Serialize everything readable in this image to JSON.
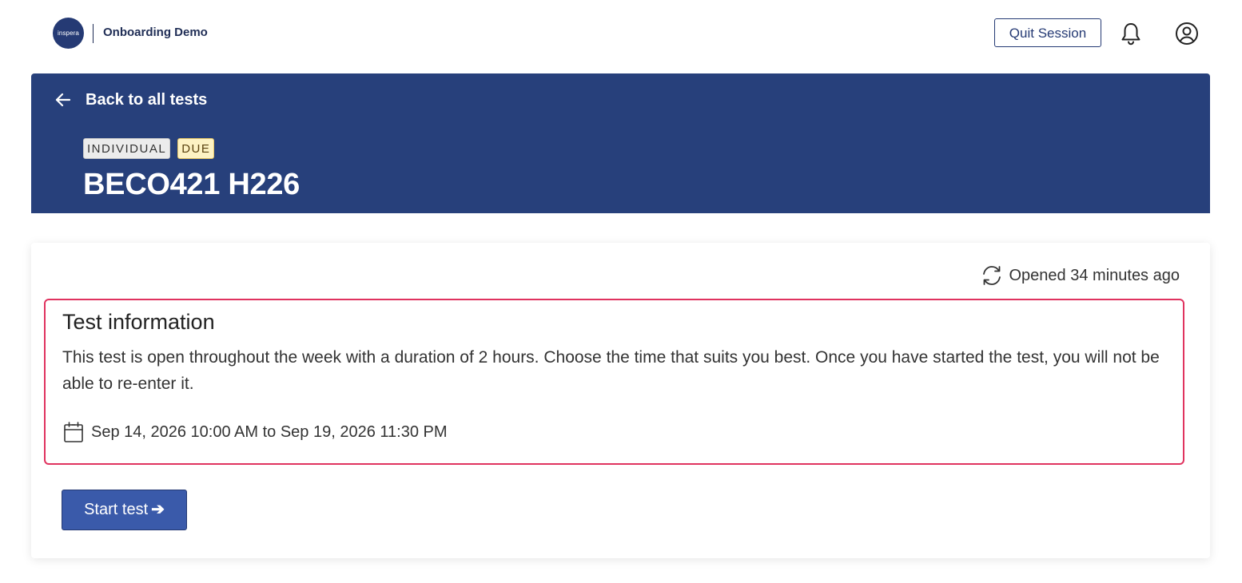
{
  "header": {
    "logo_text": "inspera",
    "brand_name": "Onboarding Demo",
    "quit_label": "Quit Session",
    "icons": [
      "bell-icon",
      "user-icon"
    ]
  },
  "hero": {
    "back_label": "Back to all tests",
    "badges": {
      "type": "INDIVIDUAL",
      "status": "DUE"
    },
    "title": "BECO421 H226"
  },
  "card": {
    "opened_text": "Opened 34 minutes ago",
    "info": {
      "title": "Test information",
      "description": "This test is open throughout the week with a duration of 2 hours. Choose the time that suits you best. Once you have started the test, you will not be able to re-enter it.",
      "dates": "Sep 14, 2026 10:00 AM to Sep 19, 2026 11:30 PM"
    },
    "start_label": "Start test",
    "start_arrow": "➔"
  },
  "colors": {
    "hero_background": "#27407b",
    "accent": "#253a74",
    "start_button": "#3a5aaa",
    "highlight_border": "#e0335f",
    "badge_due": "#fdf2c4"
  }
}
